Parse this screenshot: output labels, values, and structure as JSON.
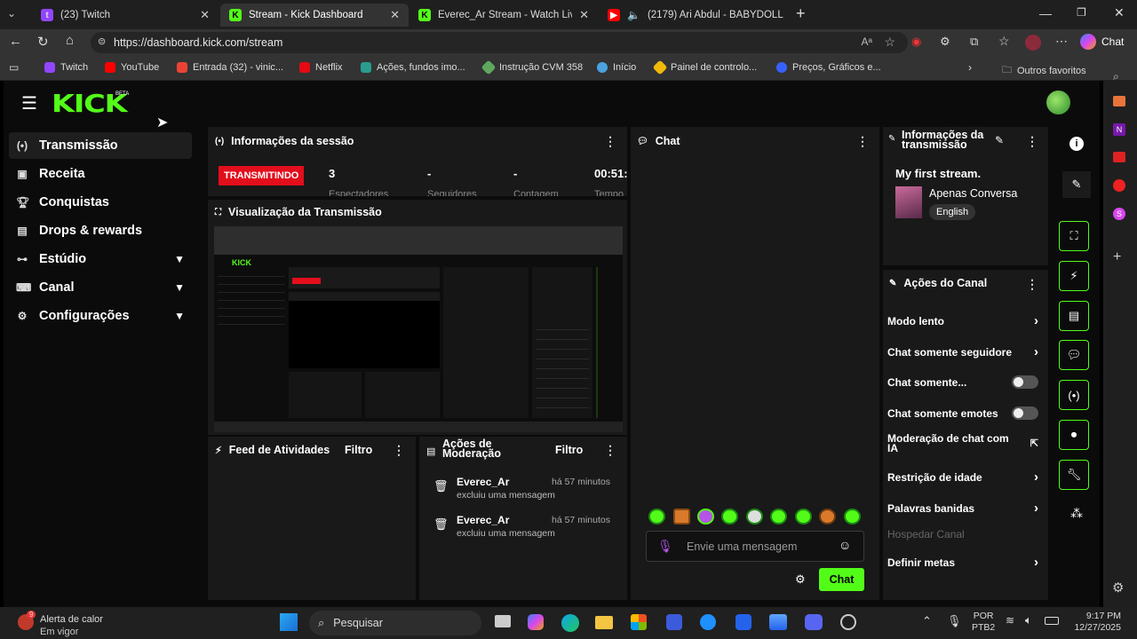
{
  "browser": {
    "tabs": [
      {
        "title": "(23) Twitch",
        "icon": "twitch-icon"
      },
      {
        "title": "Stream - Kick Dashboard",
        "icon": "kick-icon"
      },
      {
        "title": "Everec_Ar Stream - Watch Live on Ki",
        "icon": "kick-icon"
      },
      {
        "title": "(2179) Ari Abdul - BABYDOLL",
        "icon": "youtube-icon"
      }
    ],
    "url": "https://dashboard.kick.com/stream",
    "copilot_label": "Chat",
    "bookmarks": [
      "Twitch",
      "YouTube",
      "Entrada (32) - vinic...",
      "Netflix",
      "Ações, fundos imo...",
      "Instrução CVM 358",
      "Início",
      "Painel de controlo...",
      "Preços, Gráficos e..."
    ],
    "other_favorites": "Outros favoritos"
  },
  "kick": {
    "logo_beta": "BETA",
    "nav": [
      {
        "label": "Transmissão",
        "icon": "broadcast-icon"
      },
      {
        "label": "Receita",
        "icon": "revenue-icon"
      },
      {
        "label": "Conquistas",
        "icon": "trophy-icon"
      },
      {
        "label": "Drops & rewards",
        "icon": "drops-icon"
      },
      {
        "label": "Estúdio",
        "icon": "studio-icon"
      },
      {
        "label": "Canal",
        "icon": "channel-icon"
      },
      {
        "label": "Configurações",
        "icon": "gear-icon"
      }
    ],
    "session": {
      "title": "Informações da sessão",
      "status": "TRANSMITINDO",
      "stats": [
        {
          "value": "3",
          "label": "Espectadores"
        },
        {
          "value": "-",
          "label": "Seguidores"
        },
        {
          "value": "-",
          "label": "Contagem"
        },
        {
          "value": "00:51:",
          "label": "Tempo"
        }
      ]
    },
    "preview": {
      "title": "Visualização da Transmissão"
    },
    "activity": {
      "title": "Feed de Atividades",
      "filter": "Filtro"
    },
    "moderation": {
      "title": "Ações de Moderação",
      "filter": "Filtro",
      "items": [
        {
          "user": "Everec_Ar",
          "time": "há 57 minutos",
          "action": "excluiu uma mensagem"
        },
        {
          "user": "Everec_Ar",
          "time": "há 57 minutos",
          "action": "excluiu uma mensagem"
        }
      ]
    },
    "chat": {
      "title": "Chat",
      "placeholder": "Envie uma mensagem",
      "send": "Chat"
    },
    "stream_info": {
      "title": "Informações da transmissão",
      "stream_title": "My first stream.",
      "category": "Apenas Conversa",
      "language": "English"
    },
    "channel_actions": {
      "title": "Ações do Canal",
      "items": [
        {
          "label": "Modo lento",
          "control": "chevron"
        },
        {
          "label": "Chat somente seguidore",
          "control": "chevron"
        },
        {
          "label": "Chat somente...",
          "control": "toggle"
        },
        {
          "label": "Chat somente emotes",
          "control": "toggle"
        },
        {
          "label": "Moderação de chat com IA",
          "control": "external"
        },
        {
          "label": "Restrição de idade",
          "control": "chevron"
        },
        {
          "label": "Palavras banidas",
          "control": "chevron"
        },
        {
          "label": "Hospedar Canal",
          "control": "disabled"
        },
        {
          "label": "Definir metas",
          "control": "chevron"
        }
      ]
    }
  },
  "taskbar": {
    "weather_badge": "9",
    "weather_title": "Alerta de calor",
    "weather_sub": "Em vigor",
    "search": "Pesquisar",
    "lang1": "POR",
    "lang2": "PTB2",
    "time": "9:17 PM",
    "date": "12/27/2025"
  },
  "colors": {
    "kick_green": "#53fc18",
    "live_red": "#e30e1c",
    "panel": "#191919"
  }
}
